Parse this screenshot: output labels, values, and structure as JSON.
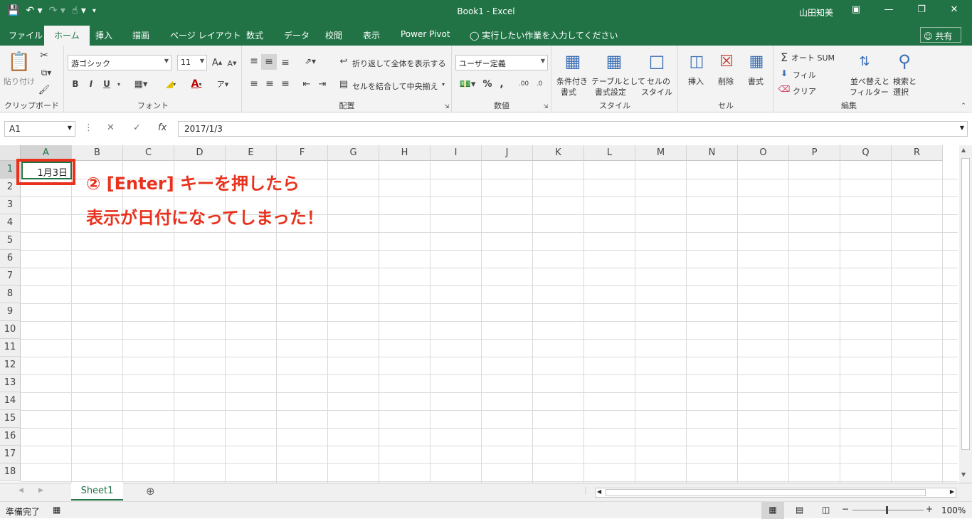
{
  "app": {
    "title": "Book1 - Excel",
    "user": "山田知美"
  },
  "window_controls": [
    "ribbon-options",
    "minimize",
    "restore",
    "close"
  ],
  "tabs": [
    "ファイル",
    "ホーム",
    "挿入",
    "描画",
    "ページ レイアウト",
    "数式",
    "データ",
    "校閲",
    "表示",
    "Power Pivot"
  ],
  "active_tab": "ホーム",
  "tell_me": "実行したい作業を入力してください",
  "share": "共有",
  "ribbon": {
    "clipboard": {
      "label": "クリップボード",
      "paste": "貼り付け"
    },
    "font": {
      "label": "フォント",
      "name": "游ゴシック",
      "size": "11",
      "bold": "B",
      "italic": "I",
      "underline": "U"
    },
    "alignment": {
      "label": "配置",
      "wrap": "折り返して全体を表示する",
      "merge": "セルを結合して中央揃え"
    },
    "number": {
      "label": "数値",
      "format": "ユーザー定義",
      "percent": "%",
      "comma": ","
    },
    "styles": {
      "label": "スタイル",
      "conditional": [
        "条件付き",
        "書式"
      ],
      "table": [
        "テーブルとして",
        "書式設定"
      ],
      "cell": [
        "セルの",
        "スタイル"
      ]
    },
    "cells": {
      "label": "セル",
      "insert": "挿入",
      "delete": "削除",
      "format": "書式"
    },
    "editing": {
      "label": "編集",
      "autosum": "オート SUM",
      "fill": "フィル",
      "clear": "クリア",
      "sort": [
        "並べ替えと",
        "フィルター"
      ],
      "find": [
        "検索と",
        "選択"
      ]
    }
  },
  "formula_bar": {
    "name_box": "A1",
    "fx": "fx",
    "formula": "2017/1/3"
  },
  "columns": [
    "A",
    "B",
    "C",
    "D",
    "E",
    "F",
    "G",
    "H",
    "I",
    "J",
    "K",
    "L",
    "M",
    "N",
    "O",
    "P",
    "Q",
    "R"
  ],
  "rows": [
    "1",
    "2",
    "3",
    "4",
    "5",
    "6",
    "7",
    "8",
    "9",
    "10",
    "11",
    "12",
    "13",
    "14",
    "15",
    "16",
    "17",
    "18"
  ],
  "cell_a1": "1月3日",
  "annotation": {
    "line1": "② [Enter] キーを押したら",
    "line2": "表示が日付になってしまった！"
  },
  "sheet_tab": "Sheet1",
  "status": {
    "ready": "準備完了",
    "zoom": "100%"
  },
  "colors": {
    "brand": "#217346",
    "annotation": "#e8321e"
  }
}
